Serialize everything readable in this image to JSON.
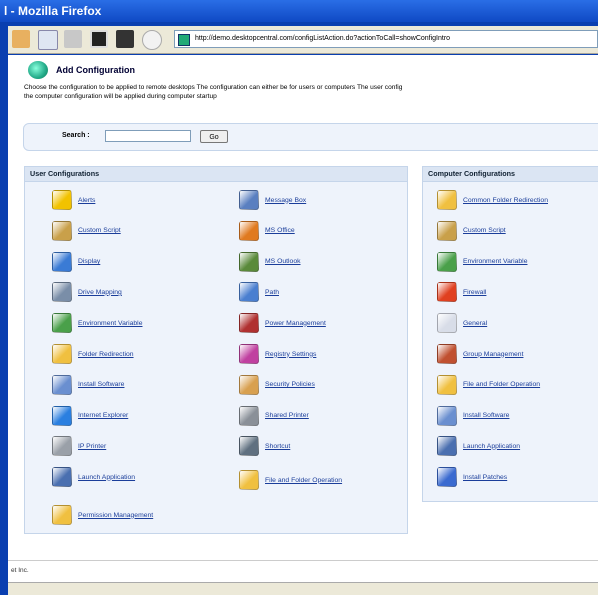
{
  "window": {
    "title": "l - Mozilla Firefox"
  },
  "browser": {
    "url": "http://demo.desktopcentral.com/configListAction.do?actionToCall=showConfigIntro"
  },
  "page": {
    "title": "Add Configuration",
    "description_line1": "Choose the configuration to be applied to remote desktops The configuration can either be for users or computers The user config",
    "description_line2": "the computer configuration will be applied during computer startup"
  },
  "search": {
    "label": "Search :",
    "value": "",
    "go_label": "Go"
  },
  "user_configs": {
    "title": "User Configurations",
    "left_items": [
      {
        "label": "Alerts",
        "icon": "alert-icon",
        "color": "#f2c200"
      },
      {
        "label": "Custom Script",
        "icon": "script-icon",
        "color": "#c9a04a"
      },
      {
        "label": "Display",
        "icon": "display-icon",
        "color": "#3a7bd5"
      },
      {
        "label": "Drive Mapping",
        "icon": "drive-icon",
        "color": "#7a8ea8"
      },
      {
        "label": "Environment Variable",
        "icon": "env-var-icon",
        "color": "#4aa04a"
      },
      {
        "label": "Folder Redirection",
        "icon": "folder-redirect-icon",
        "color": "#f0c040"
      },
      {
        "label": "Install Software",
        "icon": "install-software-icon",
        "color": "#6a8fd0"
      },
      {
        "label": "Internet Explorer",
        "icon": "ie-icon",
        "color": "#2a7fe0"
      },
      {
        "label": "IP Printer",
        "icon": "printer-icon",
        "color": "#9aa0a8"
      },
      {
        "label": "Launch Application",
        "icon": "launch-app-icon",
        "color": "#4a6fb0"
      },
      {
        "label": "Permission Management",
        "icon": "permission-icon",
        "color": "#f0c040"
      }
    ],
    "right_items": [
      {
        "label": "Message Box",
        "icon": "message-box-icon",
        "color": "#5a7fc0"
      },
      {
        "label": "MS Office",
        "icon": "ms-office-icon",
        "color": "#e07a20"
      },
      {
        "label": "MS Outlook",
        "icon": "outlook-icon",
        "color": "#5a8a3a"
      },
      {
        "label": "Path",
        "icon": "path-icon",
        "color": "#4a7fd0"
      },
      {
        "label": "Power Management",
        "icon": "power-icon",
        "color": "#b03030"
      },
      {
        "label": "Registry Settings",
        "icon": "registry-icon",
        "color": "#c040a0"
      },
      {
        "label": "Security Policies",
        "icon": "lock-icon",
        "color": "#d8a050"
      },
      {
        "label": "Shared Printer",
        "icon": "shared-printer-icon",
        "color": "#8a9098"
      },
      {
        "label": "Shortcut",
        "icon": "shortcut-icon",
        "color": "#607080"
      },
      {
        "label": "File and Folder Operation",
        "icon": "file-folder-icon",
        "color": "#f0c040"
      }
    ]
  },
  "computer_configs": {
    "title": "Computer Configurations",
    "items": [
      {
        "label": "Common Folder Redirection",
        "icon": "folder-redirect-icon",
        "color": "#f0c040"
      },
      {
        "label": "Custom Script",
        "icon": "script-icon",
        "color": "#c9a04a"
      },
      {
        "label": "Environment Variable",
        "icon": "env-var-icon",
        "color": "#4aa04a"
      },
      {
        "label": "Firewall",
        "icon": "firewall-icon",
        "color": "#e04020"
      },
      {
        "label": "General",
        "icon": "general-icon",
        "color": "#d8dde8"
      },
      {
        "label": "Group Management",
        "icon": "group-icon",
        "color": "#c05030"
      },
      {
        "label": "File and Folder Operation",
        "icon": "file-folder-icon",
        "color": "#f0c040"
      },
      {
        "label": "Install Software",
        "icon": "install-software-icon",
        "color": "#6a8fd0"
      },
      {
        "label": "Launch Application",
        "icon": "launch-app-icon",
        "color": "#4a6fb0"
      },
      {
        "label": "Install Patches",
        "icon": "patch-icon",
        "color": "#3a6ad0"
      }
    ]
  },
  "footer": {
    "text": "et Inc."
  }
}
